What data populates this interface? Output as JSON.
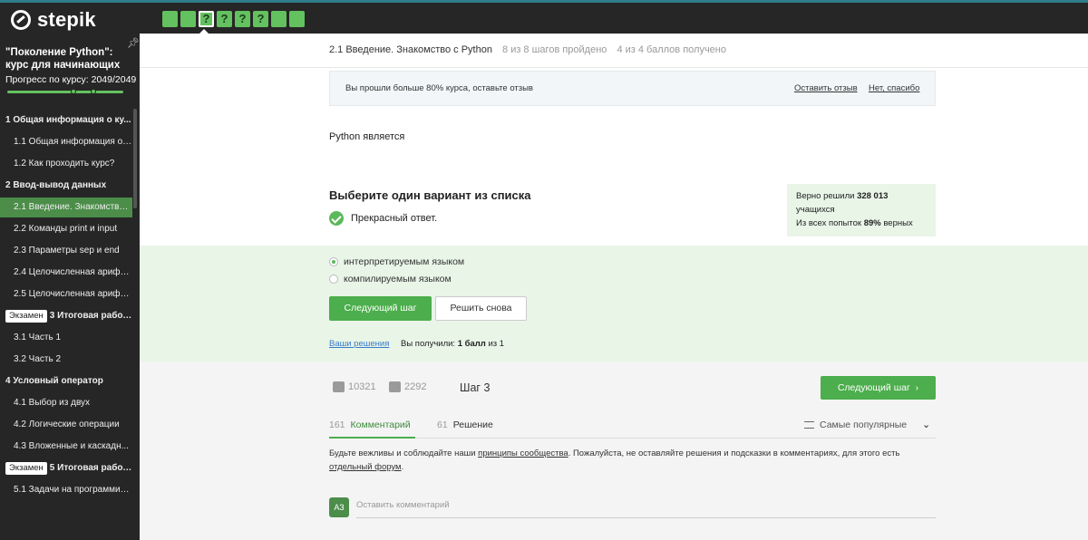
{
  "topbar": {
    "logo_text": "stepik",
    "steps": [
      "",
      "",
      "?",
      "?",
      "?",
      "?",
      "",
      ""
    ]
  },
  "sidebar": {
    "course_title": "\"Поколение Python\": курс для начинающих",
    "progress_label": "Прогресс по курсу:  2049/2049",
    "items": [
      {
        "label": "1  Общая информация о ку...",
        "kind": "section"
      },
      {
        "label": "1.1  Общая информация о ...",
        "kind": "lesson"
      },
      {
        "label": "1.2  Как проходить курс?",
        "kind": "lesson"
      },
      {
        "label": "2  Ввод-вывод данных",
        "kind": "section"
      },
      {
        "label": "2.1  Введение. Знакомство ...",
        "kind": "lesson-active"
      },
      {
        "label": "2.2  Команды print и input",
        "kind": "lesson"
      },
      {
        "label": "2.3  Параметры sep и end",
        "kind": "lesson"
      },
      {
        "label": "2.4  Целочисленная арифм...",
        "kind": "lesson"
      },
      {
        "label": "2.5  Целочисленная арифм...",
        "kind": "lesson"
      },
      {
        "label": "3  Итоговая работа...",
        "kind": "section-exam",
        "badge": "Экзамен"
      },
      {
        "label": "3.1  Часть 1",
        "kind": "lesson"
      },
      {
        "label": "3.2  Часть 2",
        "kind": "lesson"
      },
      {
        "label": "4  Условный оператор",
        "kind": "section"
      },
      {
        "label": "4.1  Выбор из двух",
        "kind": "lesson"
      },
      {
        "label": "4.2  Логические операции",
        "kind": "lesson"
      },
      {
        "label": "4.3  Вложенные и каскадн...",
        "kind": "lesson"
      },
      {
        "label": "5  Итоговая работа...",
        "kind": "section-exam",
        "badge": "Экзамен"
      },
      {
        "label": "5.1  Задачи на программир...",
        "kind": "lesson"
      }
    ]
  },
  "header": {
    "lesson": "2.1 Введение. Знакомство с Python",
    "steps_done": "8 из 8 шагов пройдено",
    "points": "4 из 4 баллов  получено"
  },
  "notice": {
    "text": "Вы прошли больше 80% курса, оставьте отзыв",
    "leave_review": "Оставить отзыв",
    "no_thanks": "Нет, спасибо"
  },
  "question": {
    "text": "Python является",
    "choose_label": "Выберите один вариант из списка",
    "feedback": "Прекрасный ответ.",
    "options": [
      "интерпретируемым языком",
      "компилируемым языком"
    ],
    "selected_index": 0
  },
  "stats": {
    "line1": "Верно решили ",
    "solved_count": "328 013",
    "line2": "учащихся",
    "line3a": "Из всех попыток ",
    "percent": "89%",
    "line3b": " верных"
  },
  "actions": {
    "next_step": "Следующий шаг",
    "solve_again": "Решить снова",
    "your_solutions": "Ваши решения",
    "score_prefix": "Вы получили: ",
    "score_value": "1 балл",
    "score_suffix": " из 1"
  },
  "footer": {
    "likes": "10321",
    "dislikes": "2292",
    "step_label": "Шаг 3",
    "next_step": "Следующий шаг",
    "comments_count": "161",
    "comments_tab": "Комментарий",
    "solutions_count": "61",
    "solutions_tab": "Решение",
    "sort_label": "Самые популярные",
    "rules_a": "Будьте вежливы и соблюдайте наши ",
    "rules_link1": "принципы сообщества",
    "rules_b": ". Пожалуйста, не оставляйте решения и подсказки в комментариях, для этого есть ",
    "rules_link2": "отдельный форум",
    "rules_c": ".",
    "avatar_initials": "АЗ",
    "comment_placeholder": "Оставить комментарий"
  }
}
